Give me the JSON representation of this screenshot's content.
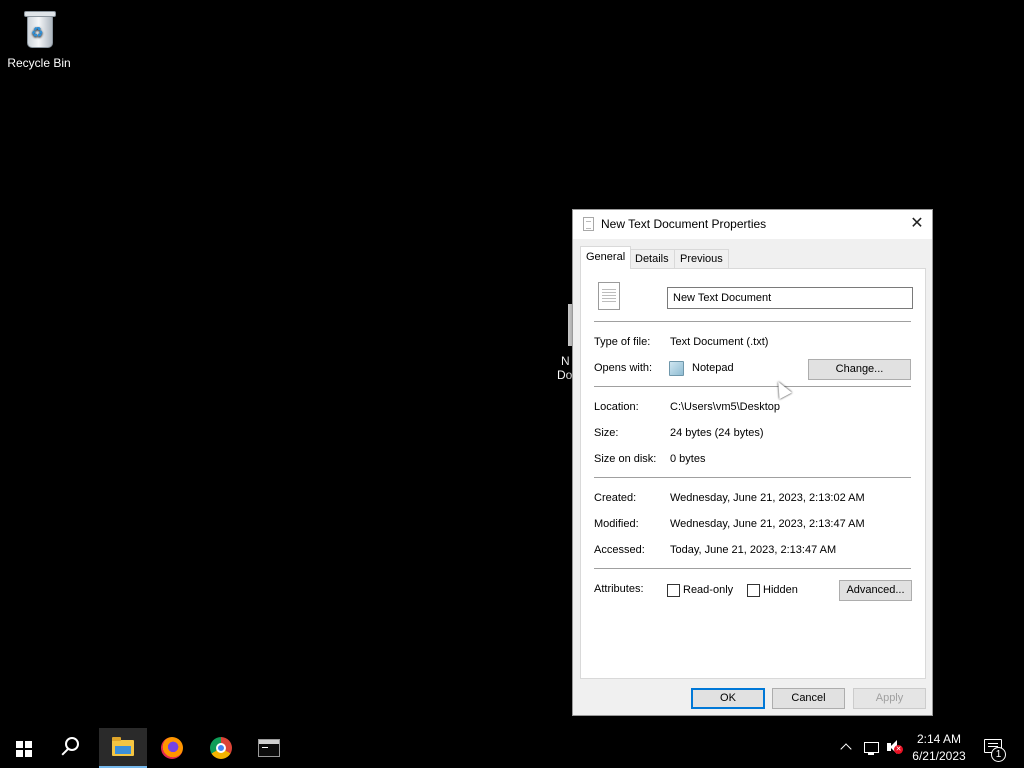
{
  "desktop": {
    "recycle_bin_label": "Recycle Bin",
    "hidden_file_label_line1": "N",
    "hidden_file_label_line2": "Do"
  },
  "dialog": {
    "title": "New Text Document Properties",
    "close_glyph": "✕",
    "tabs": [
      {
        "label": "General",
        "active": true
      },
      {
        "label": "Details",
        "active": false
      },
      {
        "label": "Previous Versions",
        "active": false
      }
    ],
    "file_name": "New Text Document",
    "type_label": "Type of file:",
    "type_value": "Text Document (.txt)",
    "opens_label": "Opens with:",
    "opens_value": "Notepad",
    "change_button": "Change...",
    "location_label": "Location:",
    "location_value": "C:\\Users\\vm5\\Desktop",
    "size_label": "Size:",
    "size_value": "24 bytes (24 bytes)",
    "size_on_disk_label": "Size on disk:",
    "size_on_disk_value": "0 bytes",
    "created_label": "Created:",
    "created_value": "Wednesday, June 21, 2023, 2:13:02 AM",
    "modified_label": "Modified:",
    "modified_value": "Wednesday, June 21, 2023, 2:13:47 AM",
    "accessed_label": "Accessed:",
    "accessed_value": "Today, June 21, 2023, 2:13:47 AM",
    "attributes_label": "Attributes:",
    "readonly_label": "Read-only",
    "readonly_checked": false,
    "hidden_label": "Hidden",
    "hidden_checked": false,
    "advanced_button": "Advanced...",
    "ok_button": "OK",
    "cancel_button": "Cancel",
    "apply_button": "Apply",
    "apply_enabled": false
  },
  "taskbar": {
    "apps": [
      {
        "name": "start",
        "icon": "windows-logo-icon"
      },
      {
        "name": "search",
        "icon": "search-icon"
      },
      {
        "name": "file-explorer",
        "icon": "folder-icon",
        "active": true
      },
      {
        "name": "firefox",
        "icon": "firefox-icon"
      },
      {
        "name": "chrome",
        "icon": "chrome-icon"
      },
      {
        "name": "terminal",
        "icon": "terminal-icon"
      }
    ],
    "tray": {
      "time": "2:14 AM",
      "date": "6/21/2023",
      "notification_count": "1",
      "volume_muted": true
    },
    "accent_color": "#76b9ed"
  }
}
